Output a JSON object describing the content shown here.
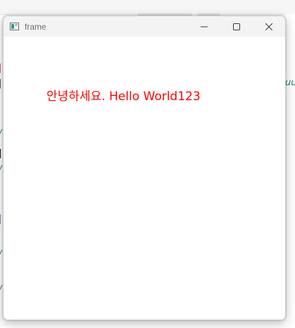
{
  "window": {
    "title": "frame",
    "icon": "app-frame-icon",
    "buttons": {
      "minimize_icon": "minimize-icon",
      "maximize_icon": "maximize-icon",
      "close_icon": "close-icon"
    }
  },
  "content": {
    "text": "안녕하세요. Hello World123",
    "text_color": "#ff0000"
  },
  "background": {
    "code_fragments": [
      "in",
      "uu"
    ]
  },
  "colors": {
    "titlebar": "#f3f3f3",
    "window_bg": "#ffffff",
    "code_keyword": "#c9344a",
    "code_italic": "#2a7f86"
  }
}
